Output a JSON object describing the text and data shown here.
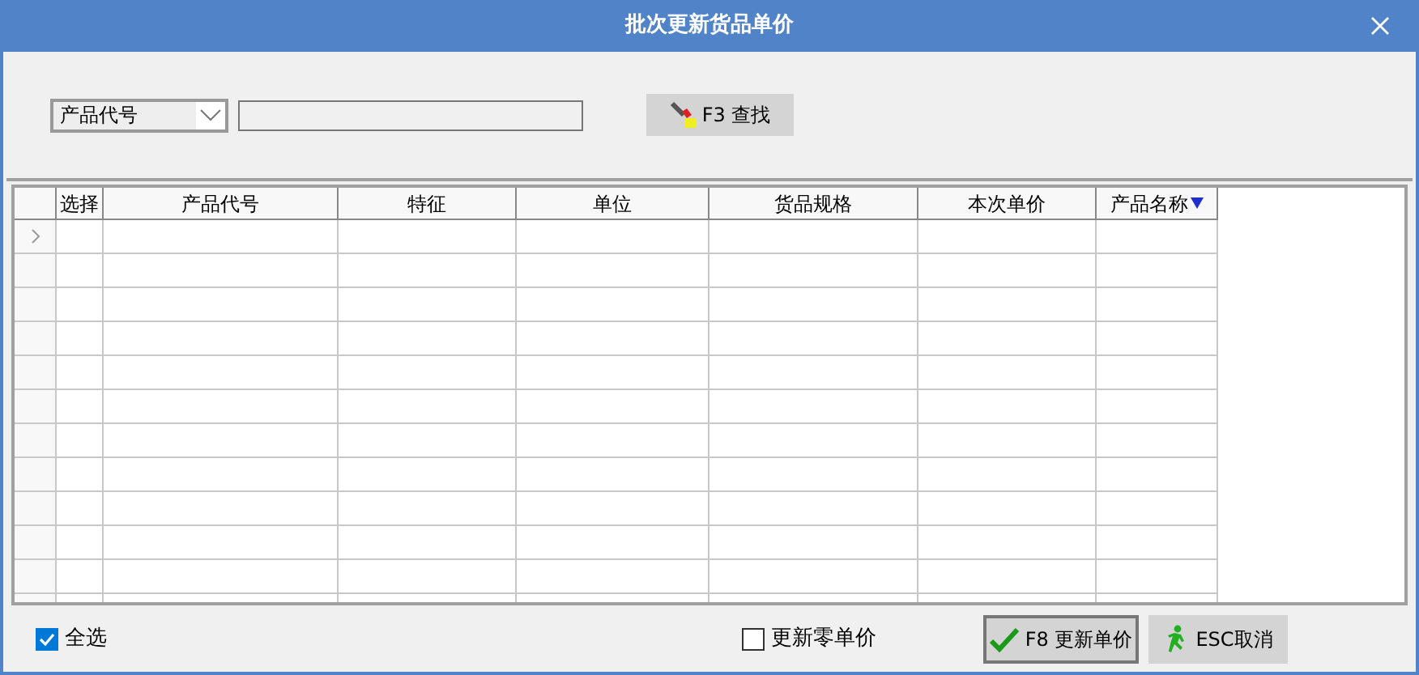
{
  "window": {
    "title": "批次更新货品单价"
  },
  "search": {
    "field_select": "产品代号",
    "button": "F3 查找"
  },
  "table": {
    "columns": [
      {
        "label": "选择",
        "sorted": false
      },
      {
        "label": "产品代号",
        "sorted": false
      },
      {
        "label": "特征",
        "sorted": false
      },
      {
        "label": "单位",
        "sorted": false
      },
      {
        "label": "货品规格",
        "sorted": false
      },
      {
        "label": "本次单价",
        "sorted": false
      },
      {
        "label": "产品名称",
        "sorted": true
      }
    ]
  },
  "footer": {
    "select_all": {
      "label": "全选",
      "checked": true
    },
    "zero_price": {
      "label": "更新零单价",
      "checked": false
    },
    "buttons": [
      {
        "kind": "confirm",
        "label": "F8 更新单价"
      },
      {
        "kind": "cancel",
        "label": "ESC取消"
      }
    ]
  }
}
